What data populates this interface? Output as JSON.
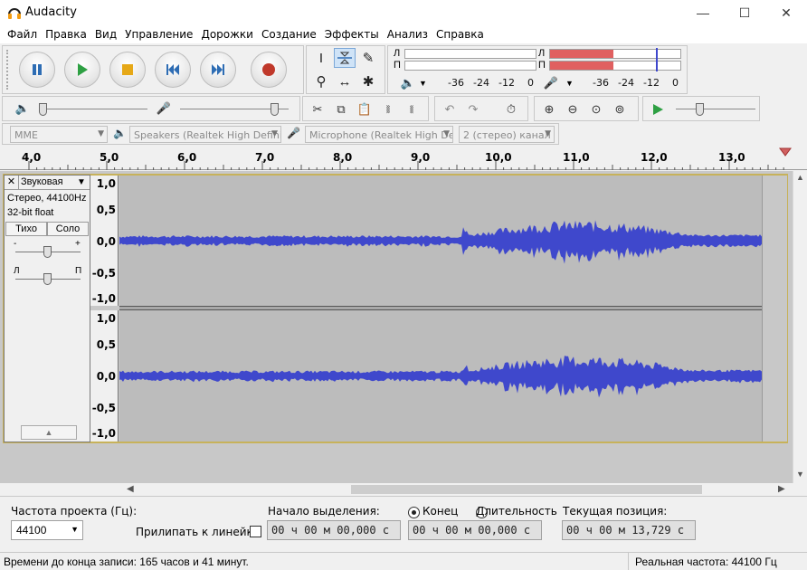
{
  "window": {
    "title": "Audacity",
    "minimize": "—",
    "maximize": "☐",
    "close": "✕"
  },
  "menu": [
    "Файл",
    "Правка",
    "Вид",
    "Управление",
    "Дорожки",
    "Создание",
    "Эффекты",
    "Анализ",
    "Справка"
  ],
  "transport": {
    "pause_icon": "pause-icon",
    "play_icon": "play-icon",
    "stop_icon": "stop-icon",
    "skip_start_icon": "skip-to-start-icon",
    "skip_end_icon": "skip-to-end-icon",
    "record_icon": "record-icon",
    "record_color": "#c0392b"
  },
  "meters": {
    "play_left": "Л",
    "play_right": "П",
    "rec_left": "Л",
    "rec_right": "П",
    "ticks": [
      "-36",
      "-24",
      "-12",
      "0"
    ],
    "ticks_rec": [
      "-36",
      "-24",
      "-12",
      "0"
    ],
    "rec_meter_color": "#e06060"
  },
  "device": {
    "host": "MME",
    "output": "Speakers (Realtek High Definit",
    "input": "Microphone (Realtek High Defi",
    "channels": "2 (стерео) канал"
  },
  "ruler": [
    "4,0",
    "5,0",
    "6,0",
    "7,0",
    "8,0",
    "9,0",
    "10,0",
    "11,0",
    "12,0",
    "13,0"
  ],
  "track": {
    "name": "Звуковая",
    "info1": "Стерео, 44100Hz",
    "info2": "32-bit float",
    "mute": "Тихо",
    "solo": "Соло",
    "gain_minus": "-",
    "gain_plus": "+",
    "pan_left": "Л",
    "pan_right": "П",
    "scale_top": [
      "1,0",
      "0,5",
      "0,0",
      "-0,5",
      "-1,0"
    ],
    "scale_bottom": [
      "1,0",
      "0,5",
      "0,0",
      "-0,5",
      "-1,0"
    ],
    "wave_color": "#3f48cc"
  },
  "selection": {
    "rate_label": "Частота проекта (Гц):",
    "rate_value": "44100",
    "snap_label": "Прилипать к линейке",
    "start_label": "Начало выделения:",
    "end_label": "Конец",
    "length_label": "Длительность",
    "pos_label": "Текущая позиция:",
    "start_value": "00 ч 00 м 00,000 с",
    "end_value": "00 ч 00 м 00,000 с",
    "pos_value": "00 ч 00 м 13,729 с"
  },
  "status": {
    "left": "Времени до конца записи: 165 часов и 41 минут.",
    "right": "Реальная частота: 44100 Гц"
  }
}
